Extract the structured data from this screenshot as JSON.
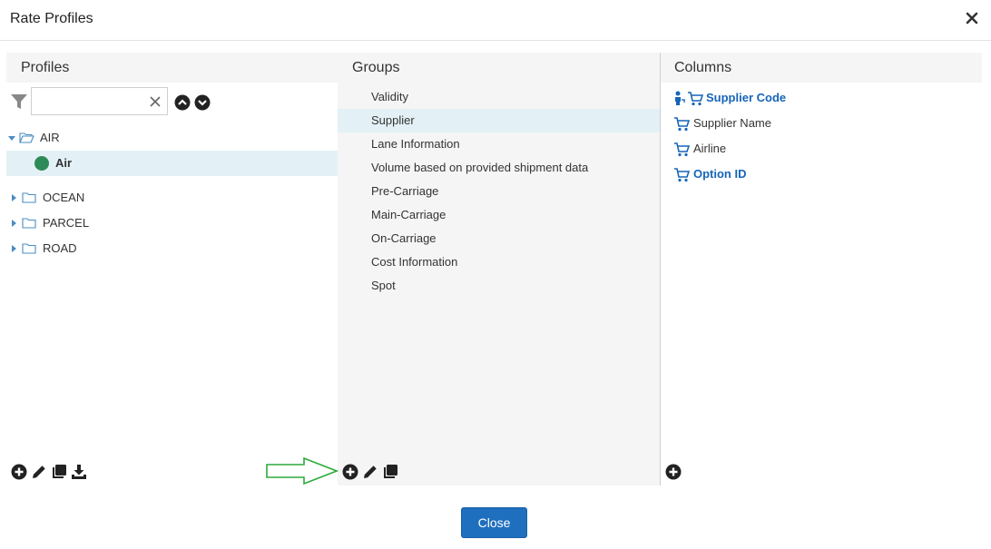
{
  "dialog": {
    "title": "Rate Profiles",
    "close_label": "Close"
  },
  "profiles": {
    "header": "Profiles",
    "search": {
      "value": "",
      "placeholder": ""
    },
    "tree": [
      {
        "label": "AIR",
        "expanded": true
      },
      {
        "label": "Air",
        "selected": true,
        "status_color": "#2e8b57"
      },
      {
        "label": "OCEAN",
        "expanded": false
      },
      {
        "label": "PARCEL",
        "expanded": false
      },
      {
        "label": "ROAD",
        "expanded": false
      }
    ]
  },
  "groups": {
    "header": "Groups",
    "items": [
      {
        "label": "Validity"
      },
      {
        "label": "Supplier",
        "selected": true
      },
      {
        "label": "Lane Information"
      },
      {
        "label": "Volume based on provided shipment data"
      },
      {
        "label": "Pre-Carriage"
      },
      {
        "label": "Main-Carriage"
      },
      {
        "label": "On-Carriage"
      },
      {
        "label": "Cost Information"
      },
      {
        "label": "Spot"
      }
    ]
  },
  "columns": {
    "header": "Columns",
    "items": [
      {
        "label": "Supplier Code",
        "bold": true,
        "icons": [
          "person-key-icon",
          "cart-icon"
        ]
      },
      {
        "label": "Supplier Name",
        "bold": false,
        "icons": [
          "cart-icon"
        ]
      },
      {
        "label": "Airline",
        "bold": false,
        "icons": [
          "cart-icon"
        ]
      },
      {
        "label": "Option ID",
        "bold": true,
        "icons": [
          "cart-icon"
        ]
      }
    ]
  },
  "colors": {
    "accent": "#1f6fbf",
    "link": "#1565b8",
    "selected_bg": "#e3f1f6",
    "arrow": "#2eaa3c"
  }
}
